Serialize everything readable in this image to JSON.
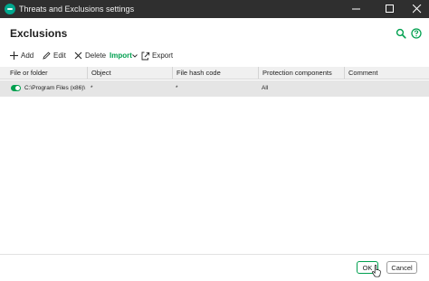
{
  "window": {
    "title": "Threats and Exclusions settings"
  },
  "page": {
    "heading": "Exclusions"
  },
  "toolbar": {
    "add_label": "Add",
    "edit_label": "Edit",
    "delete_label": "Delete",
    "import_label": "Import",
    "export_label": "Export"
  },
  "table": {
    "columns": [
      "File or folder",
      "Object",
      "File hash code",
      "Protection components",
      "Comment"
    ],
    "rows": [
      {
        "enabled": true,
        "file_or_folder": "C:\\Program Files (x86)\\",
        "object": "*",
        "file_hash_code": "*",
        "protection_components": "All",
        "comment": ""
      }
    ]
  },
  "footer": {
    "ok_label": "OK",
    "cancel_label": "Cancel"
  },
  "colors": {
    "accent_green": "#00a04f",
    "titlebar": "#2f2f2f",
    "logo_teal": "#00a88e",
    "header_bg": "#f0f0f0",
    "selected_row": "#e5e5e5"
  },
  "icons": [
    "app-logo-icon",
    "minimize-icon",
    "maximize-icon",
    "close-icon",
    "search-icon",
    "help-icon",
    "plus-icon",
    "pencil-icon",
    "x-icon",
    "chevron-down-icon",
    "export-icon",
    "cursor-icon"
  ]
}
